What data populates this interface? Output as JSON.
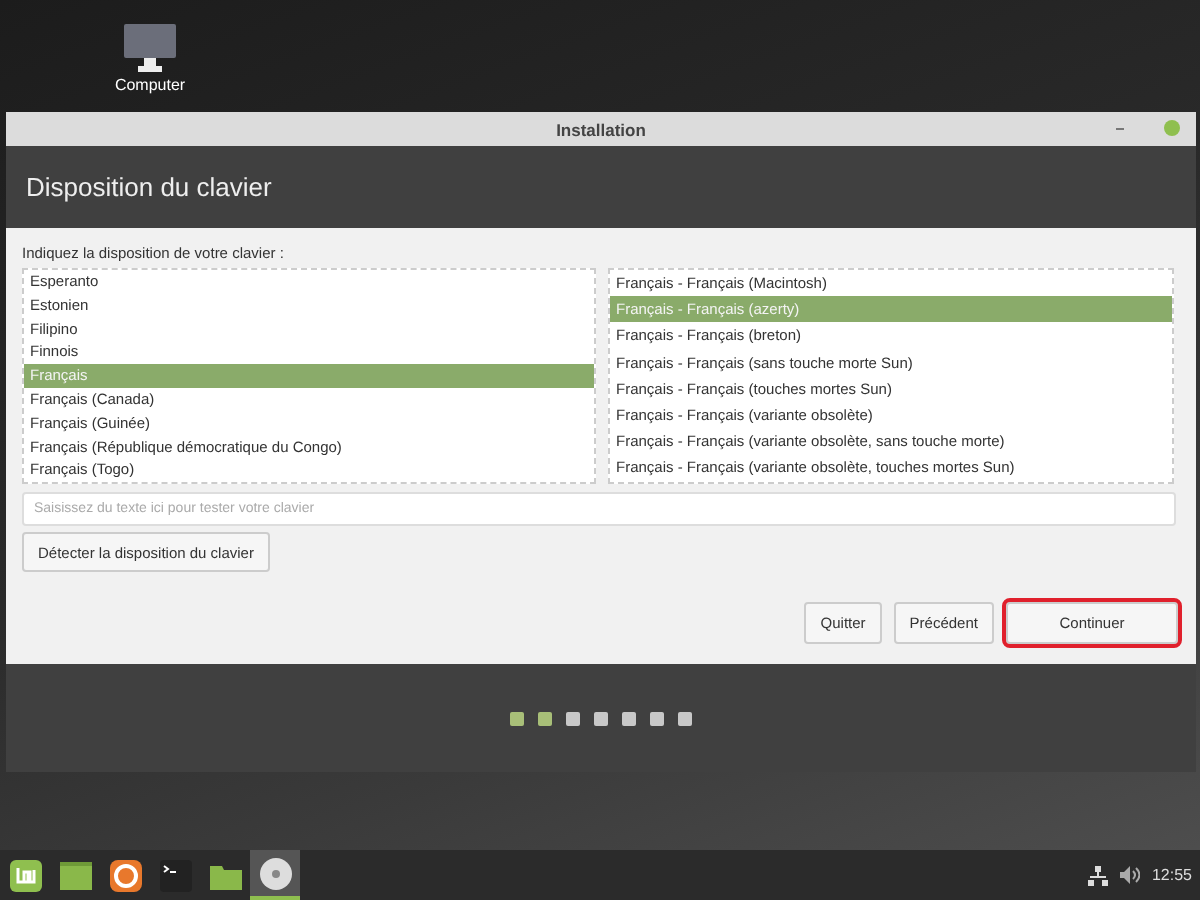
{
  "desktop": {
    "icons": [
      {
        "label": "Computer"
      }
    ]
  },
  "window": {
    "title": "Installation"
  },
  "header": {
    "title": "Disposition du clavier"
  },
  "prompt": "Indiquez la disposition de votre clavier :",
  "layouts": [
    {
      "label": "Esperanto",
      "selected": false
    },
    {
      "label": "Estonien",
      "selected": false
    },
    {
      "label": "Filipino",
      "selected": false
    },
    {
      "label": "Finnois",
      "selected": false
    },
    {
      "label": "Français",
      "selected": true
    },
    {
      "label": "Français (Canada)",
      "selected": false
    },
    {
      "label": "Français (Guinée)",
      "selected": false
    },
    {
      "label": "Français (République démocratique du Congo)",
      "selected": false
    },
    {
      "label": "Français (Togo)",
      "selected": false
    }
  ],
  "variants": [
    {
      "label": "Français - Français (Macintosh)",
      "selected": false
    },
    {
      "label": "Français - Français (azerty)",
      "selected": true
    },
    {
      "label": "Français - Français (breton)",
      "selected": false
    },
    {
      "label": "Français - Français (sans touche morte Sun)",
      "selected": false
    },
    {
      "label": "Français - Français (touches mortes Sun)",
      "selected": false
    },
    {
      "label": "Français - Français (variante obsolète)",
      "selected": false
    },
    {
      "label": "Français - Français (variante obsolète, sans touche morte)",
      "selected": false
    },
    {
      "label": "Français - Français (variante obsolète, touches mortes Sun)",
      "selected": false
    }
  ],
  "test_field": {
    "placeholder": "Saisissez du texte ici pour tester votre clavier"
  },
  "detect_button": "Détecter la disposition du clavier",
  "buttons": [
    {
      "label": "Quitter",
      "highlighted": false
    },
    {
      "label": "Précédent",
      "highlighted": false
    },
    {
      "label": "Continuer",
      "highlighted": true
    }
  ],
  "progress": [
    {
      "done": true
    },
    {
      "done": true
    },
    {
      "done": false
    },
    {
      "done": false
    },
    {
      "done": false
    },
    {
      "done": false
    },
    {
      "done": false
    }
  ],
  "taskbar": {
    "items": [
      {
        "kind": "menu",
        "active": false
      },
      {
        "kind": "desktop",
        "active": false
      },
      {
        "kind": "browser",
        "active": false
      },
      {
        "kind": "terminal",
        "active": false
      },
      {
        "kind": "folder",
        "active": false
      },
      {
        "kind": "disc",
        "active": true
      }
    ],
    "clock": "12:55"
  }
}
